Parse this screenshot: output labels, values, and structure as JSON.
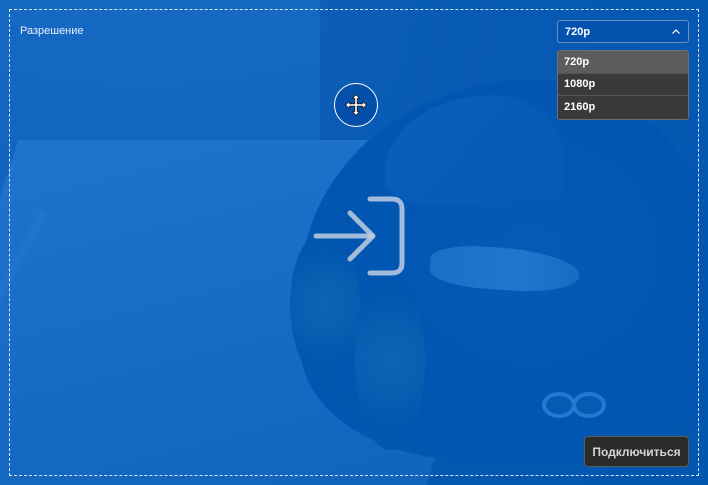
{
  "overlay": {
    "resolution_label": "Разрешение",
    "selected_resolution": "720p",
    "options": [
      "720p",
      "1080p",
      "2160p"
    ],
    "connect_label": "Подключиться"
  },
  "icons": {
    "move": "move-arrows-icon",
    "enter": "enter-arrow-icon",
    "chevron": "chevron-up-icon"
  },
  "colors": {
    "overlay_blue": "#0066d4",
    "dropdown_bg": "#3a3a3a",
    "dropdown_selected": "#5c5c5c",
    "button_bg": "#2b2b2b"
  }
}
